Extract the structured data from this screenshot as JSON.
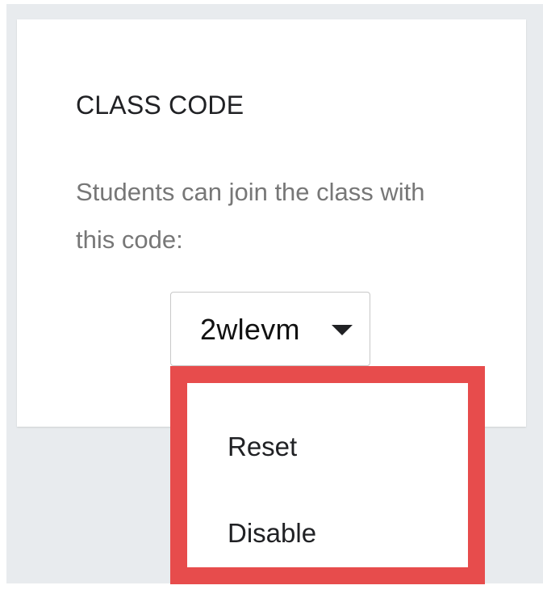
{
  "class_code_card": {
    "title": "CLASS CODE",
    "description": "Students can join the class with this code:",
    "code": "2wlevm",
    "caret_icon": "caret-down-icon"
  },
  "code_menu": {
    "items": [
      {
        "label": "Reset"
      },
      {
        "label": "Disable"
      }
    ],
    "highlight_color": "#e74c4c"
  },
  "colors": {
    "page_background": "#e8ebee",
    "card_background": "#ffffff",
    "title_text": "#202124",
    "description_text": "#777777"
  }
}
